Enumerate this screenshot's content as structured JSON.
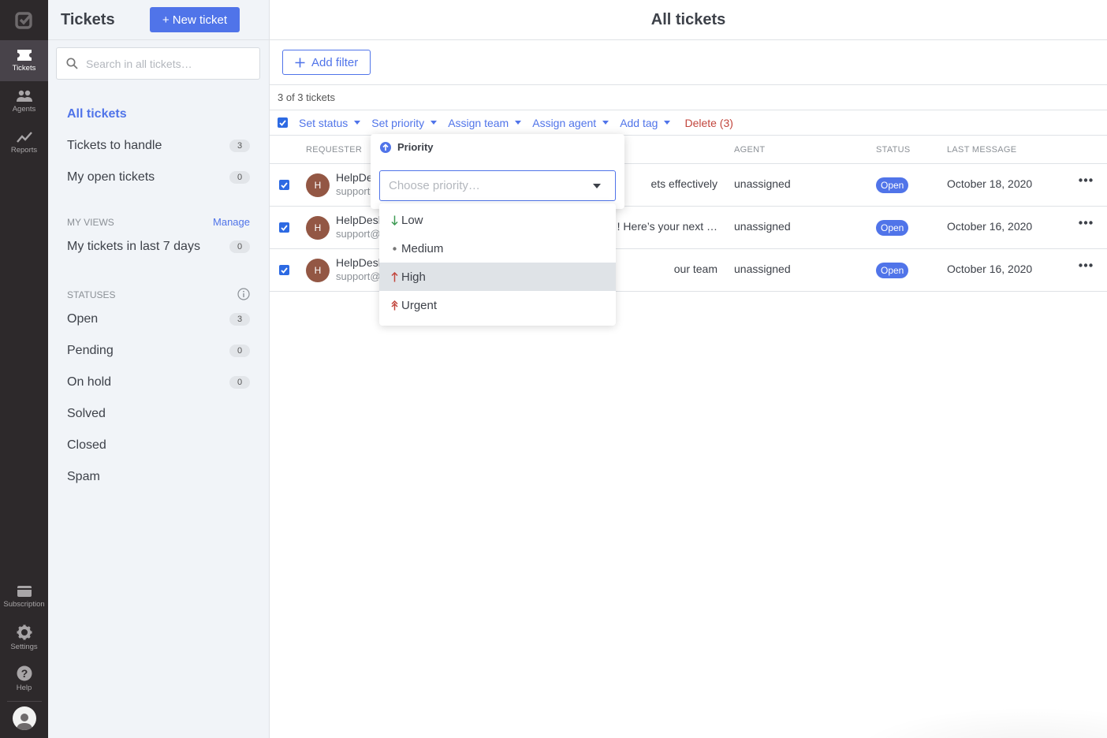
{
  "rail": {
    "items": [
      {
        "label": "Tickets",
        "icon": "ticket-icon",
        "active": true
      },
      {
        "label": "Agents",
        "icon": "agents-icon"
      },
      {
        "label": "Reports",
        "icon": "reports-icon"
      }
    ],
    "bottom": [
      {
        "label": "Subscription",
        "icon": "subscription-icon"
      },
      {
        "label": "Settings",
        "icon": "gear-icon"
      },
      {
        "label": "Help",
        "icon": "help-icon"
      }
    ]
  },
  "sidebar": {
    "title": "Tickets",
    "new_ticket_label": "+ New ticket",
    "search_placeholder": "Search in all tickets…",
    "nav": [
      {
        "label": "All tickets",
        "active": true
      },
      {
        "label": "Tickets to handle",
        "count": "3"
      },
      {
        "label": "My open tickets",
        "count": "0"
      }
    ],
    "my_views": {
      "heading": "My views",
      "manage_label": "Manage",
      "items": [
        {
          "label": "My tickets in last 7 days",
          "count": "0"
        }
      ]
    },
    "statuses": {
      "heading": "Statuses",
      "items": [
        {
          "label": "Open",
          "count": "3"
        },
        {
          "label": "Pending",
          "count": "0"
        },
        {
          "label": "On hold",
          "count": "0"
        },
        {
          "label": "Solved"
        },
        {
          "label": "Closed"
        },
        {
          "label": "Spam"
        }
      ]
    }
  },
  "main": {
    "title": "All tickets",
    "add_filter_label": "Add filter",
    "ticket_count": "3 of 3 tickets",
    "bulk_actions": {
      "set_status": "Set status",
      "set_priority": "Set priority",
      "assign_team": "Assign team",
      "assign_agent": "Assign agent",
      "add_tag": "Add tag",
      "delete": "Delete (3)"
    },
    "columns": {
      "requester": "Requester",
      "agent": "Agent",
      "status": "Status",
      "last_message": "Last message"
    },
    "rows": [
      {
        "avatar": "H",
        "requester": "HelpDe",
        "email": "support",
        "subject": "ets effectively",
        "agent": "unassigned",
        "status": "Open",
        "last_message": "October 18, 2020"
      },
      {
        "avatar": "H",
        "requester": "HelpDesk",
        "email": "support@",
        "subject": "! Here’s your next …",
        "agent": "unassigned",
        "status": "Open",
        "last_message": "October 16, 2020"
      },
      {
        "avatar": "H",
        "requester": "HelpDesk",
        "email": "support@",
        "subject": "our team",
        "agent": "unassigned",
        "status": "Open",
        "last_message": "October 16, 2020"
      }
    ]
  },
  "priority_popover": {
    "title": "Priority",
    "placeholder": "Choose priority…",
    "options": [
      {
        "label": "Low",
        "icon": "arrow-down-icon",
        "color": "#3f9b55"
      },
      {
        "label": "Medium",
        "icon": "dot-icon",
        "color": "#777777"
      },
      {
        "label": "High",
        "icon": "arrow-up-icon",
        "color": "#c2463d",
        "highlighted": true
      },
      {
        "label": "Urgent",
        "icon": "double-arrow-up-icon",
        "color": "#c2463d"
      }
    ]
  },
  "colors": {
    "accent": "#5074e9",
    "danger": "#c2463d",
    "rail_bg": "#2d292b",
    "sidebar_bg": "#f1f4f8",
    "avatar_bg": "#935744"
  }
}
